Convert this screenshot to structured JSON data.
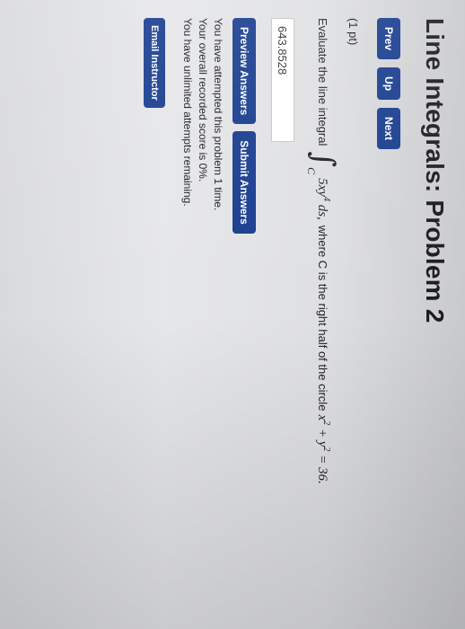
{
  "header": {
    "title": "Line Integrals: Problem 2"
  },
  "nav": {
    "prev": "Prev",
    "up": "Up",
    "next": "Next"
  },
  "problem": {
    "points": "(1 pt)",
    "prompt": "Evaluate the line integral",
    "integral_subscript": "C",
    "integrand": "5xy",
    "integrand_exp": "4",
    "differential": " ds,",
    "condition_text": "where C is the right half of the circle",
    "circle_x": "x",
    "circle_x_exp": "2",
    "circle_plus": " + ",
    "circle_y": "y",
    "circle_y_exp": "2",
    "circle_rhs": " = 36."
  },
  "answer": {
    "value": "643.8528"
  },
  "actions": {
    "preview": "Preview Answers",
    "submit": "Submit Answers"
  },
  "status": {
    "line1": "You have attempted this problem 1 time.",
    "line2": "Your overall recorded score is 0%.",
    "line3": "You have unlimited attempts remaining."
  },
  "footer": {
    "email": "Email Instructor"
  }
}
